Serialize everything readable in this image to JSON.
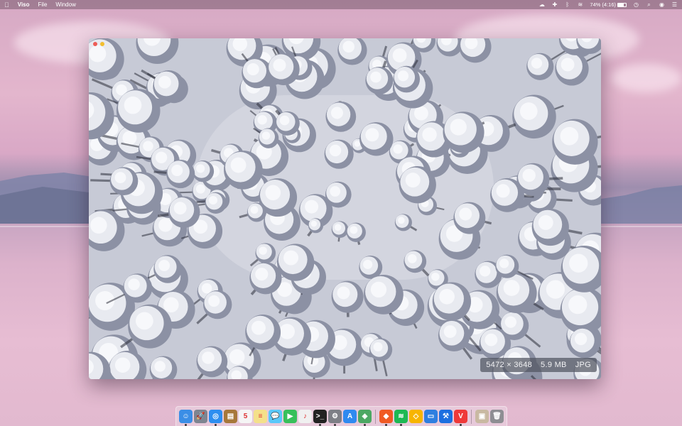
{
  "menubar": {
    "apple_icon": "apple-icon",
    "app_name": "Viso",
    "menus": [
      "File",
      "Window"
    ],
    "battery_text": "74% (4:16)",
    "status_icons": [
      "creative-cloud-icon",
      "plus-icon",
      "bluetooth-icon",
      "wifi-icon",
      "battery-icon",
      "clock-icon",
      "search-icon",
      "siri-icon",
      "notification-center-icon"
    ]
  },
  "viewer": {
    "dimensions": "5472 × 3648",
    "file_size": "5.9 MB",
    "format": "JPG"
  },
  "dock": {
    "apps": [
      {
        "name": "finder-icon",
        "color": "#3b8ee6"
      },
      {
        "name": "launchpad-icon",
        "color": "#7e8591"
      },
      {
        "name": "safari-icon",
        "color": "#2d8ef0"
      },
      {
        "name": "notefile-icon",
        "color": "#a7783a"
      },
      {
        "name": "calendar-icon",
        "color": "#f5f5f5"
      },
      {
        "name": "notes-icon",
        "color": "#f4e08a"
      },
      {
        "name": "messages-icon",
        "color": "#5ac8fa"
      },
      {
        "name": "facetime-icon",
        "color": "#37c05a"
      },
      {
        "name": "music-icon",
        "color": "#f0f0f0"
      },
      {
        "name": "terminal-icon",
        "color": "#222222"
      },
      {
        "name": "system-preferences-icon",
        "color": "#7d7f86"
      },
      {
        "name": "app-store-icon",
        "color": "#2f8af0"
      },
      {
        "name": "maps-icon",
        "color": "#4ca863"
      },
      {
        "name": "brave-icon",
        "color": "#f05a24"
      },
      {
        "name": "spotify-icon",
        "color": "#1db954"
      },
      {
        "name": "sketch-icon",
        "color": "#f7b500"
      },
      {
        "name": "folder-icon",
        "color": "#2f7fe0"
      },
      {
        "name": "xcode-icon",
        "color": "#1d6fe0"
      },
      {
        "name": "vivaldi-icon",
        "color": "#ef3939"
      },
      {
        "name": "downloads-icon",
        "color": "#c9b9a2"
      },
      {
        "name": "trash-icon",
        "color": "#8e8e93"
      }
    ]
  }
}
